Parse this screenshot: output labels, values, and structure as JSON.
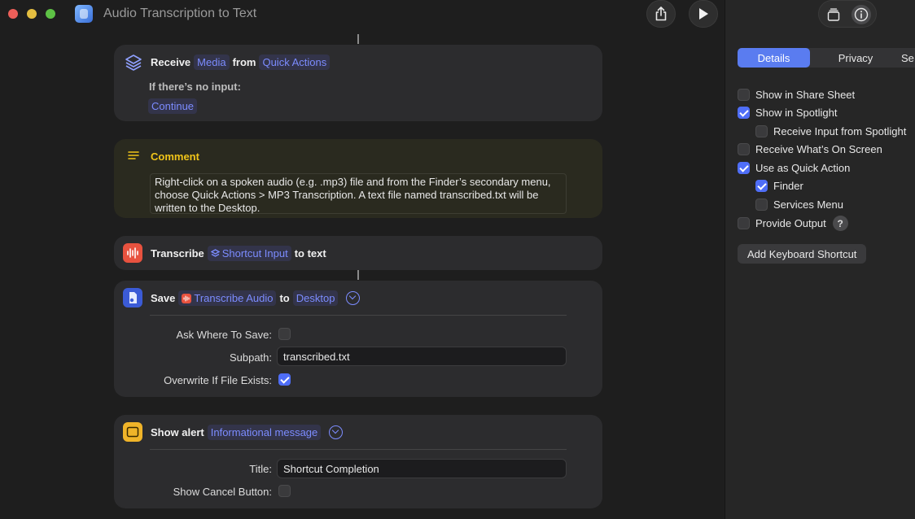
{
  "window": {
    "title": "Audio Transcription to Text"
  },
  "actions": {
    "receive": {
      "verb": "Receive",
      "input": "Media",
      "from": "from",
      "source": "Quick Actions",
      "no_input_label": "If there’s no input:",
      "no_input_value": "Continue"
    },
    "comment": {
      "title": "Comment",
      "text": "Right-click on a spoken audio (e.g. .mp3) file and from the Finder’s secondary menu, choose Quick Actions > MP3 Transcription. A text file named transcribed.txt will be written to the Desktop."
    },
    "transcribe": {
      "verb": "Transcribe",
      "input": "Shortcut Input",
      "suffix": "to text"
    },
    "save": {
      "verb": "Save",
      "input": "Transcribe Audio",
      "to": "to",
      "destination": "Desktop",
      "ask_label": "Ask Where To Save:",
      "ask_checked": false,
      "subpath_label": "Subpath:",
      "subpath_value": "transcribed.txt",
      "overwrite_label": "Overwrite If File Exists:",
      "overwrite_checked": true
    },
    "alert": {
      "verb": "Show alert",
      "input": "Informational message",
      "title_label": "Title:",
      "title_value": "Shortcut Completion",
      "cancel_label": "Show Cancel Button:",
      "cancel_checked": false
    }
  },
  "sidebar": {
    "tabs": [
      "Details",
      "Privacy",
      "Se"
    ],
    "active_tab": "Details",
    "options": [
      {
        "label": "Show in Share Sheet",
        "checked": false,
        "indent": false
      },
      {
        "label": "Show in Spotlight",
        "checked": true,
        "indent": false
      },
      {
        "label": "Receive Input from Spotlight",
        "checked": false,
        "indent": true
      },
      {
        "label": "Receive What’s On Screen",
        "checked": false,
        "indent": false
      },
      {
        "label": "Use as Quick Action",
        "checked": true,
        "indent": false
      },
      {
        "label": "Finder",
        "checked": true,
        "indent": true
      },
      {
        "label": "Services Menu",
        "checked": false,
        "indent": true
      },
      {
        "label": "Provide Output",
        "checked": false,
        "indent": false
      }
    ],
    "help_glyph": "?",
    "keyboard_button": "Add Keyboard Shortcut"
  },
  "colors": {
    "accent": "#5a7cf0",
    "token": "#7c8cff",
    "comment_title": "#f0c419"
  }
}
